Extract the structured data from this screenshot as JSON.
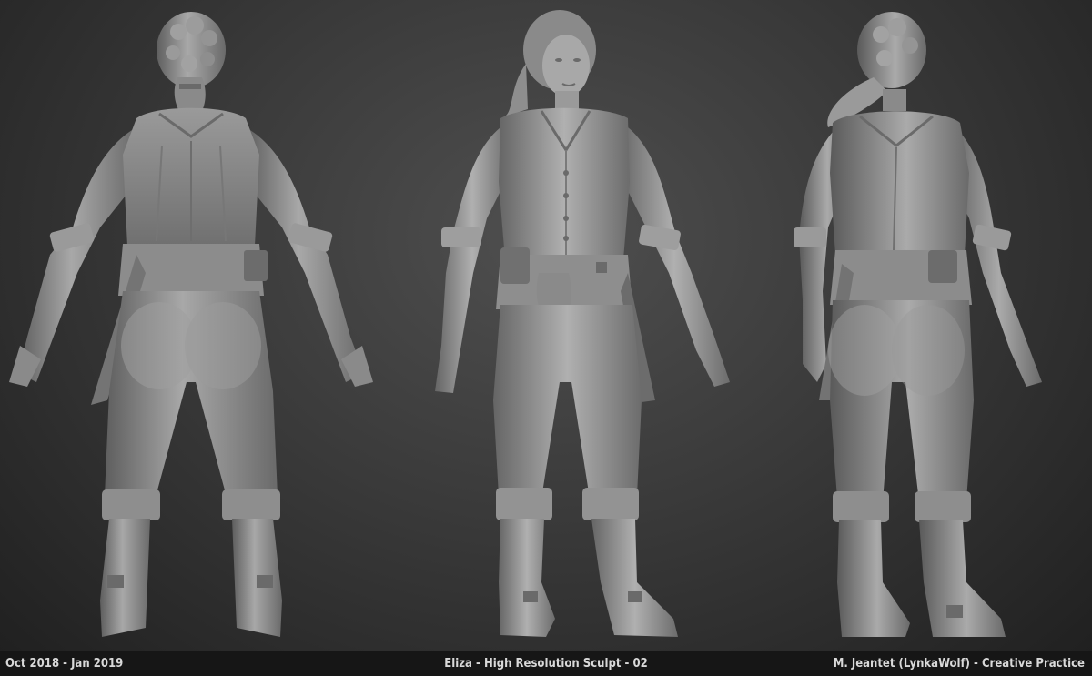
{
  "captions": {
    "date_range": "Oct 2018 - Jan 2019",
    "title": "Eliza - High Resolution Sculpt - 02",
    "credit": "M. Jeantet (LynkaWolf) - Creative Practice"
  },
  "figures": {
    "back": "back-view-sculpt",
    "front": "front-view-sculpt",
    "three_quarter": "three-quarter-back-view-sculpt"
  },
  "colors": {
    "background_center": "#4f4f4f",
    "background_edge": "#1f1f1f",
    "clay": "#8e8e8e",
    "clay_light": "#b4b4b4",
    "clay_dark": "#5e5e5e",
    "caption_bar": "#161616",
    "caption_text": "#d9d9d9"
  }
}
